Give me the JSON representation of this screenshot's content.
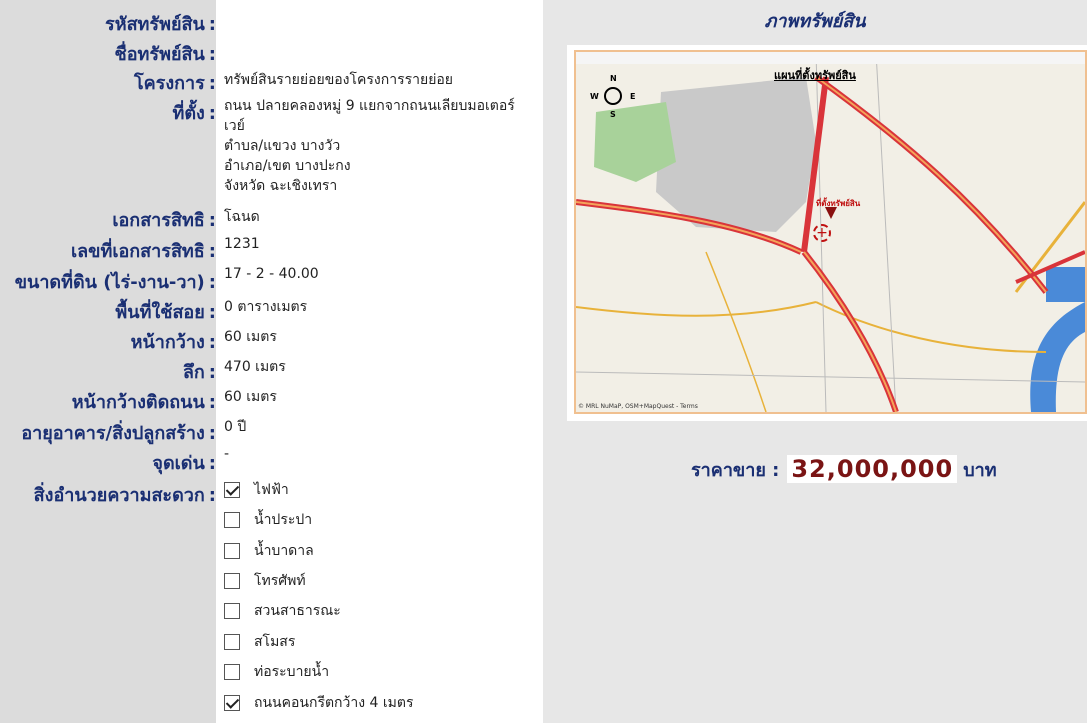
{
  "fields": {
    "asset_code": {
      "label": "รหัสทรัพย์สิน"
    },
    "asset_name": {
      "label": "ชื่อทรัพย์สิน"
    },
    "project": {
      "label": "โครงการ",
      "value": "ทรัพย์สินรายย่อยของโครงการรายย่อย"
    },
    "location": {
      "label": "ที่ตั้ง",
      "road_line1": "ถนน   ปลายคลองหมู่  9 แยกจากถนนเลียบมอเตอร์",
      "road_line2": "เวย์",
      "subdistrict": "ตำบล/แขวง   บางวัว",
      "district": "อำเภอ/เขต   บางปะกง",
      "province": "จังหวัด   ฉะเชิงเทรา"
    },
    "title_deed": {
      "label": "เอกสารสิทธิ",
      "value": "โฉนด"
    },
    "deed_no": {
      "label": "เลขที่เอกสารสิทธิ",
      "value": "1231"
    },
    "land_size": {
      "label": "ขนาดที่ดิน (ไร่-งาน-วา)",
      "value": "17 - 2 - 40.00"
    },
    "usable_area": {
      "label": "พื้นที่ใช้สอย",
      "value": "0 ตารางเมตร"
    },
    "frontage": {
      "label": "หน้ากว้าง",
      "value": "60 เมตร"
    },
    "depth": {
      "label": "ลึก",
      "value": "470 เมตร"
    },
    "road_frontage": {
      "label": "หน้ากว้างติดถนน",
      "value": "60 เมตร"
    },
    "building_age": {
      "label": "อายุอาคาร/สิ่งปลูกสร้าง",
      "value": "0 ปี"
    },
    "highlight": {
      "label": "จุดเด่น",
      "value": "-"
    },
    "facilities": {
      "label": "สิ่งอำนวยความสะดวก"
    }
  },
  "colon": ":",
  "facilities": [
    {
      "label": "ไฟฟ้า",
      "checked": true
    },
    {
      "label": "น้ำประปา",
      "checked": false
    },
    {
      "label": "น้ำบาดาล",
      "checked": false
    },
    {
      "label": "โทรศัพท์",
      "checked": false
    },
    {
      "label": "สวนสาธารณะ",
      "checked": false
    },
    {
      "label": "สโมสร",
      "checked": false
    },
    {
      "label": "ท่อระบายน้ำ",
      "checked": false
    },
    {
      "label": "ถนนคอนกรีตกว้าง   4 เมตร",
      "checked": true
    }
  ],
  "image_section": {
    "title": "ภาพทรัพย์สิน",
    "map_heading": "แผนที่ตั้งทรัพย์สิน",
    "map_marker_label": "ที่ตั้งทรัพย์สิน",
    "compass": {
      "n": "N",
      "s": "S",
      "e": "E",
      "w": "W"
    },
    "map_copyright": "© MRL NuMaP, OSM+MapQuest - Terms"
  },
  "price": {
    "label": "ราคาขาย :",
    "value": "32,000,000",
    "unit": "บาท"
  },
  "colors": {
    "label_blue": "#1a2f73",
    "price_red": "#7a1414",
    "highway": "#d9343a",
    "road_yellow": "#e8b23a"
  }
}
